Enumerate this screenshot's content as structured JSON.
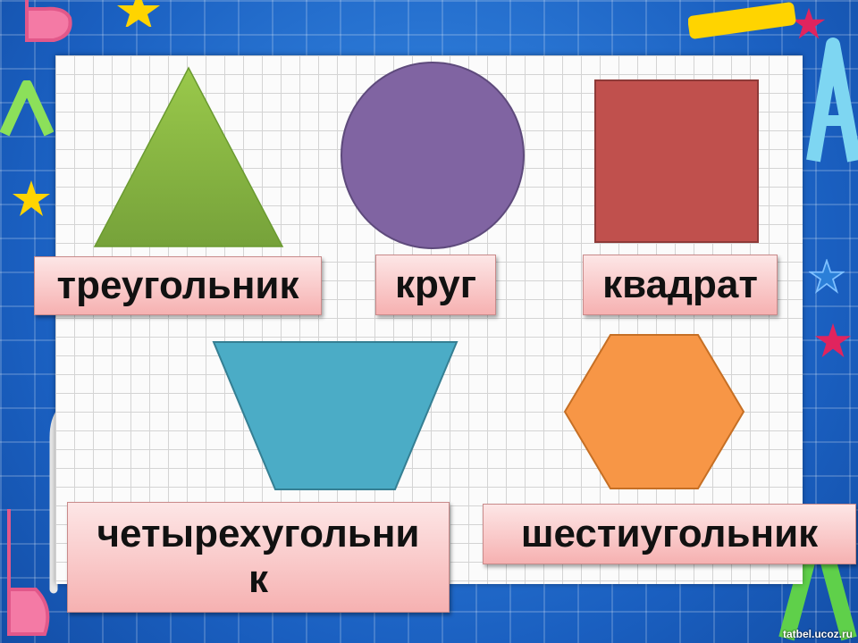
{
  "labels": {
    "triangle": "треугольник",
    "circle": "круг",
    "square": "квадрат",
    "quadrilateral": "четырехугольник",
    "hexagon": "шестиугольник"
  },
  "colors": {
    "triangle": "#8dba43",
    "circle": "#8064a2",
    "square": "#c0504d",
    "quadrilateral": "#4bacc6",
    "hexagon": "#f79646"
  },
  "credit": "tatbel.ucoz.ru"
}
